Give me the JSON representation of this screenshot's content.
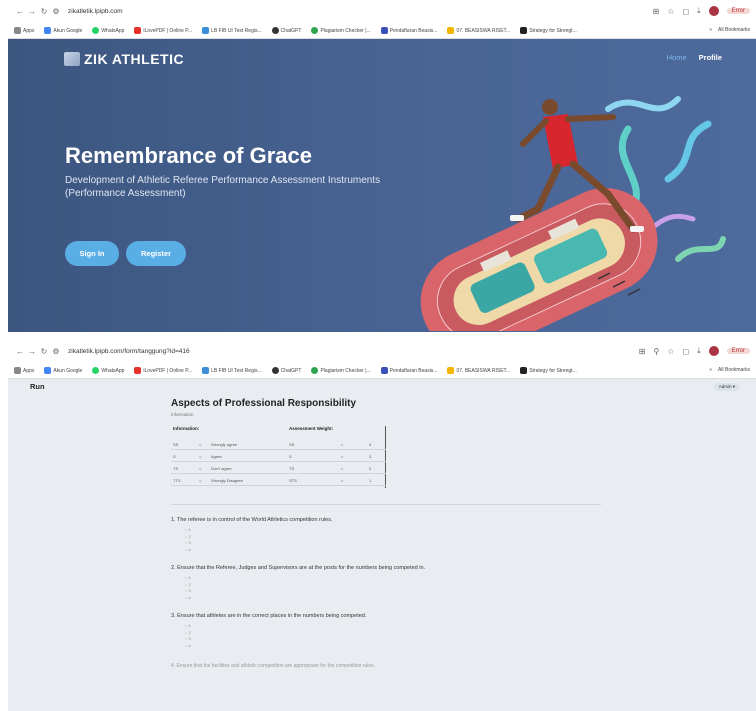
{
  "shot1": {
    "url": "zikatletik.lpipb.com",
    "bookmarks": [
      "Apps",
      "Akun Google",
      "WhatsApp",
      "iLovePDF | Online P...",
      "LB FIB UI Test Regis...",
      "ChatGPT",
      "Plagiarism Checker |...",
      "Pendaftaran Beasis...",
      "07. BEASISWA RISET...",
      "Strategy for Strengt..."
    ],
    "bookmarks_right": "All Bookmarks",
    "brand": "ZIK ATHLETIC",
    "nav": {
      "home": "Home",
      "profile": "Profile"
    },
    "hero_title": "Remembrance of Grace",
    "hero_subtitle": "Development of Athletic Referee Performance Assessment Instruments (Performance Assessment)",
    "sign_in": "Sign In",
    "register": "Register",
    "error_label": "Error"
  },
  "shot2": {
    "url": "zikatletik.lpipb.com/form/tanggung?id=416",
    "bookmarks": [
      "Apps",
      "Akun Google",
      "WhatsApp",
      "iLovePDF | Online P...",
      "LB FIB UI Test Regis...",
      "ChatGPT",
      "Plagiarism Checker |...",
      "Pendaftaran Beasis...",
      "07. BEASISWA RISET...",
      "Strategy for Strengt..."
    ],
    "bookmarks_right": "All Bookmarks",
    "error_label": "Error",
    "app_title": "Run",
    "user_menu": "Admin ▾",
    "form_title": "Aspects of Professional Responsibility",
    "form_subtitle": "Information",
    "legend_headers": {
      "information": "Information:",
      "weight": "Assessment Weight:"
    },
    "legend_rows": [
      {
        "code": "SS",
        "dash": "=",
        "label": "Strongly agree",
        "wcode": "SS",
        "wdash": "=",
        "weight": "4"
      },
      {
        "code": "S",
        "dash": "=",
        "label": "Agree",
        "wcode": "S",
        "wdash": "=",
        "weight": "3"
      },
      {
        "code": "TS",
        "dash": "=",
        "label": "Don't agree",
        "wcode": "TS",
        "wdash": "=",
        "weight": "2"
      },
      {
        "code": "TTS",
        "dash": "=",
        "label": "Strongly Disagree",
        "wcode": "STS",
        "wdash": "=",
        "weight": "1"
      }
    ],
    "questions": [
      {
        "text": "1. The referee is in control of the World Athletics competition rules.",
        "options": [
          "1",
          "2",
          "3",
          "4"
        ]
      },
      {
        "text": "2. Ensure that the Referee, Judges and Supervisors are at the posts for the numbers being competed in.",
        "options": [
          "1",
          "2",
          "3",
          "4"
        ]
      },
      {
        "text": "3. Ensure that athletes are in the correct places in the numbers being competed.",
        "options": [
          "1",
          "2",
          "3",
          "4"
        ]
      }
    ],
    "cutoff_text": "4. Ensure that the facilities and athletic competition are appropriate for the competition rules."
  }
}
